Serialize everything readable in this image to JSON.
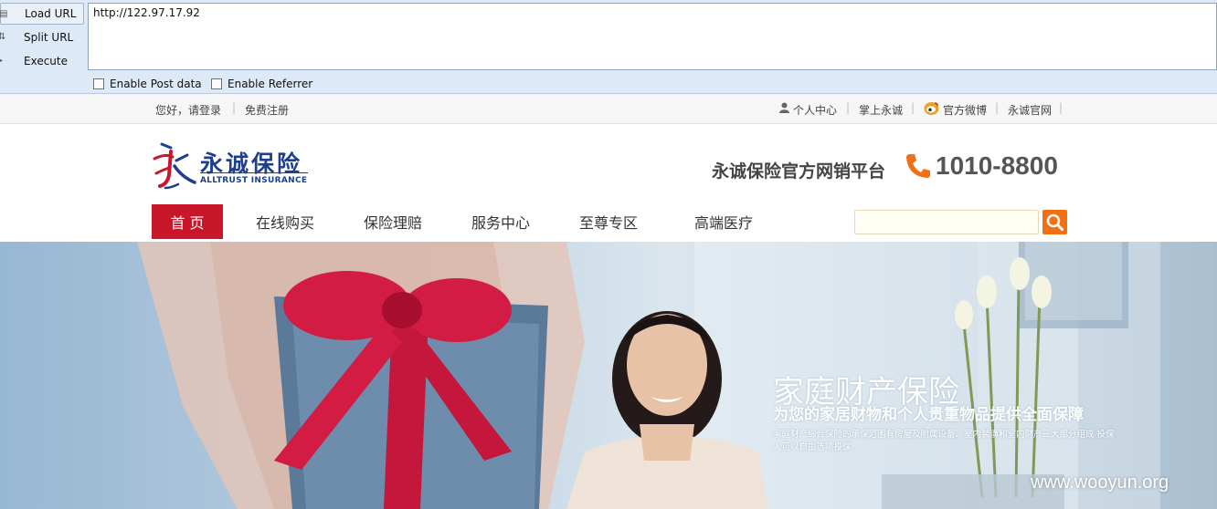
{
  "hackbar": {
    "buttons": [
      {
        "label": "Load URL",
        "icon": "load-url-icon"
      },
      {
        "label": "Split URL",
        "icon": "split-url-icon"
      },
      {
        "label": "Execute",
        "icon": "execute-icon"
      }
    ],
    "url_value": "http://122.97.17.92",
    "checkboxes": [
      {
        "label": "Enable Post data",
        "checked": false
      },
      {
        "label": "Enable Referrer",
        "checked": false
      }
    ]
  },
  "topbar": {
    "login": "您好，请登录",
    "register": "免费注册",
    "personal_center": "个人中心",
    "mobile": "掌上永诚",
    "weibo": "官方微博",
    "official_site": "永诚官网"
  },
  "header": {
    "logo_cn": "永诚保险",
    "logo_en": "ALLTRUST INSURANCE",
    "slogan": "永诚保险官方网销平台",
    "hotline": "1010-8800"
  },
  "nav": {
    "items": [
      "首 页",
      "在线购买",
      "保险理赔",
      "服务中心",
      "至尊专区",
      "高端医疗"
    ],
    "search_placeholder": ""
  },
  "banner": {
    "title": "家庭财产保险",
    "subtitle": "为您的家居财物和个人贵重物品提供全面保障",
    "description": "家庭财产综合保险的承保范围有房屋及附属设备、室内装潢和室内财产三大部分组成 投保人可以自由选项投保"
  },
  "watermark": "www.wooyun.org",
  "colors": {
    "brand_blue": "#1e3f8f",
    "nav_active": "#c8172a",
    "accent_orange": "#f36f14",
    "hackbar_bg": "#dde9f6"
  }
}
